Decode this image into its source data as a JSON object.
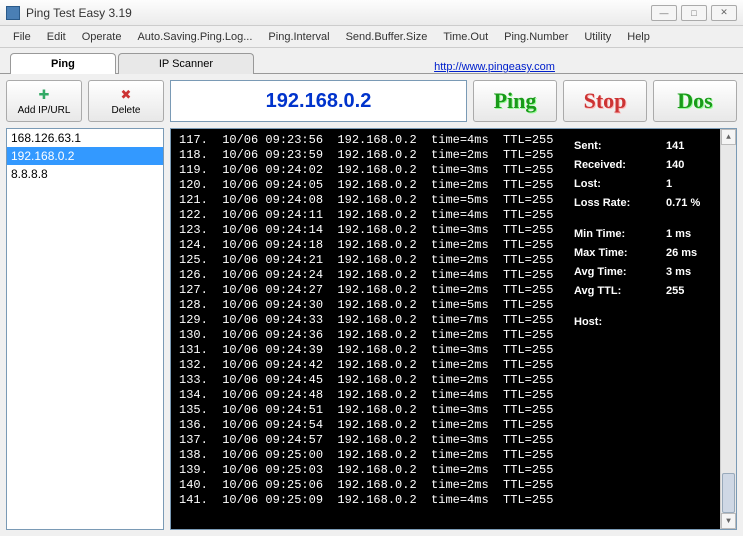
{
  "window": {
    "title": "Ping Test Easy 3.19"
  },
  "menu": [
    "File",
    "Edit",
    "Operate",
    "Auto.Saving.Ping.Log...",
    "Ping.Interval",
    "Send.Buffer.Size",
    "Time.Out",
    "Ping.Number",
    "Utility",
    "Help"
  ],
  "tabs": {
    "ping": "Ping",
    "scanner": "IP Scanner",
    "link": "http://www.pingeasy.com"
  },
  "sidebar": {
    "add_label": "Add IP/URL",
    "del_label": "Delete",
    "ips": [
      "168.126.63.1",
      "192.168.0.2",
      "8.8.8.8"
    ],
    "selected_index": 1
  },
  "input_ip": "192.168.0.2",
  "buttons": {
    "ping": "Ping",
    "stop": "Stop",
    "dos": "Dos"
  },
  "log": [
    "117.  10/06 09:23:56  192.168.0.2  time=4ms  TTL=255",
    "118.  10/06 09:23:59  192.168.0.2  time=2ms  TTL=255",
    "119.  10/06 09:24:02  192.168.0.2  time=3ms  TTL=255",
    "120.  10/06 09:24:05  192.168.0.2  time=2ms  TTL=255",
    "121.  10/06 09:24:08  192.168.0.2  time=5ms  TTL=255",
    "122.  10/06 09:24:11  192.168.0.2  time=4ms  TTL=255",
    "123.  10/06 09:24:14  192.168.0.2  time=3ms  TTL=255",
    "124.  10/06 09:24:18  192.168.0.2  time=2ms  TTL=255",
    "125.  10/06 09:24:21  192.168.0.2  time=2ms  TTL=255",
    "126.  10/06 09:24:24  192.168.0.2  time=4ms  TTL=255",
    "127.  10/06 09:24:27  192.168.0.2  time=2ms  TTL=255",
    "128.  10/06 09:24:30  192.168.0.2  time=5ms  TTL=255",
    "129.  10/06 09:24:33  192.168.0.2  time=7ms  TTL=255",
    "130.  10/06 09:24:36  192.168.0.2  time=2ms  TTL=255",
    "131.  10/06 09:24:39  192.168.0.2  time=3ms  TTL=255",
    "132.  10/06 09:24:42  192.168.0.2  time=2ms  TTL=255",
    "133.  10/06 09:24:45  192.168.0.2  time=2ms  TTL=255",
    "134.  10/06 09:24:48  192.168.0.2  time=4ms  TTL=255",
    "135.  10/06 09:24:51  192.168.0.2  time=3ms  TTL=255",
    "136.  10/06 09:24:54  192.168.0.2  time=2ms  TTL=255",
    "137.  10/06 09:24:57  192.168.0.2  time=3ms  TTL=255",
    "138.  10/06 09:25:00  192.168.0.2  time=2ms  TTL=255",
    "139.  10/06 09:25:03  192.168.0.2  time=2ms  TTL=255",
    "140.  10/06 09:25:06  192.168.0.2  time=2ms  TTL=255",
    "141.  10/06 09:25:09  192.168.0.2  time=4ms  TTL=255"
  ],
  "stats": {
    "sent_label": "Sent:",
    "sent": "141",
    "received_label": "Received:",
    "received": "140",
    "lost_label": "Lost:",
    "lost": "1",
    "lossrate_label": "Loss Rate:",
    "lossrate": "0.71 %",
    "mintime_label": "Min Time:",
    "mintime": "1 ms",
    "maxtime_label": "Max Time:",
    "maxtime": "26 ms",
    "avgtime_label": "Avg Time:",
    "avgtime": "3 ms",
    "avgttl_label": "Avg TTL:",
    "avgttl": "255",
    "host_label": "Host:",
    "host": ""
  }
}
